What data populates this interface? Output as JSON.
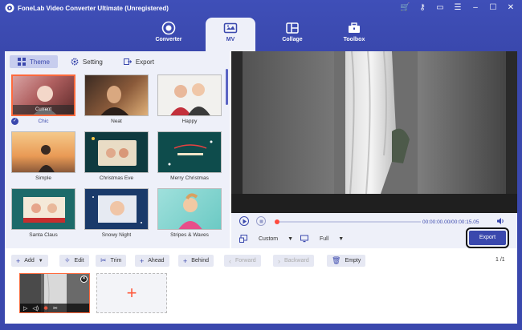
{
  "app": {
    "title": "FoneLab Video Converter Ultimate (Unregistered)",
    "window_controls": [
      "cart-icon",
      "key-icon",
      "feedback-icon",
      "menu-icon",
      "minimize-icon",
      "maximize-icon",
      "close-icon"
    ]
  },
  "nav": {
    "items": [
      {
        "label": "Converter",
        "icon": "converter-icon"
      },
      {
        "label": "MV",
        "icon": "mv-icon",
        "active": true
      },
      {
        "label": "Collage",
        "icon": "collage-icon"
      },
      {
        "label": "Toolbox",
        "icon": "toolbox-icon"
      }
    ]
  },
  "left_tabs": [
    {
      "label": "Theme",
      "active": true
    },
    {
      "label": "Setting"
    },
    {
      "label": "Export"
    }
  ],
  "themes": [
    {
      "name": "Chic",
      "selected": true,
      "badge": "Current"
    },
    {
      "name": "Neat"
    },
    {
      "name": "Happy"
    },
    {
      "name": "Simple"
    },
    {
      "name": "Christmas Eve"
    },
    {
      "name": "Merry Christmas"
    },
    {
      "name": "Santa Claus"
    },
    {
      "name": "Snowy Night"
    },
    {
      "name": "Stripes & Waves"
    }
  ],
  "player": {
    "current_time": "00:00:00.00",
    "total_time": "00:00:15.05",
    "aspect_label": "Custom",
    "mode_label": "Full",
    "export_label": "Export"
  },
  "toolbar": {
    "add": "Add",
    "edit": "Edit",
    "trim": "Trim",
    "ahead": "Ahead",
    "behind": "Behind",
    "forward": "Forward",
    "backward": "Backward",
    "empty": "Empty",
    "page": "1 /1"
  },
  "colors": {
    "brand": "#3a48ad",
    "accent": "#ff6a3d"
  }
}
